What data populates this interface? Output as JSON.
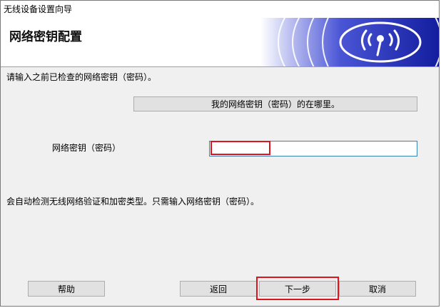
{
  "window": {
    "title": "无线设备设置向导",
    "heading": "网络密钥配置",
    "banner_icon": "wireless-signal-icon"
  },
  "main": {
    "instruction": "请输入之前已检查的网络密钥（密码）。",
    "help_link_label": "我的网络密钥（密码）的在哪里。",
    "key_field_label": "网络密钥（密码）",
    "key_field_value": "",
    "auto_note": "会自动检测无线网络验证和加密类型。只需输入网络密钥（密码）。"
  },
  "buttons": {
    "help": "帮助",
    "back": "返回",
    "next": "下一步",
    "cancel": "取消"
  },
  "colors": {
    "banner_blue": "#1a24a8",
    "highlight_red": "#e0141e",
    "dialog_bg": "#f0f0f0",
    "button_bg": "#e1e1e1"
  }
}
